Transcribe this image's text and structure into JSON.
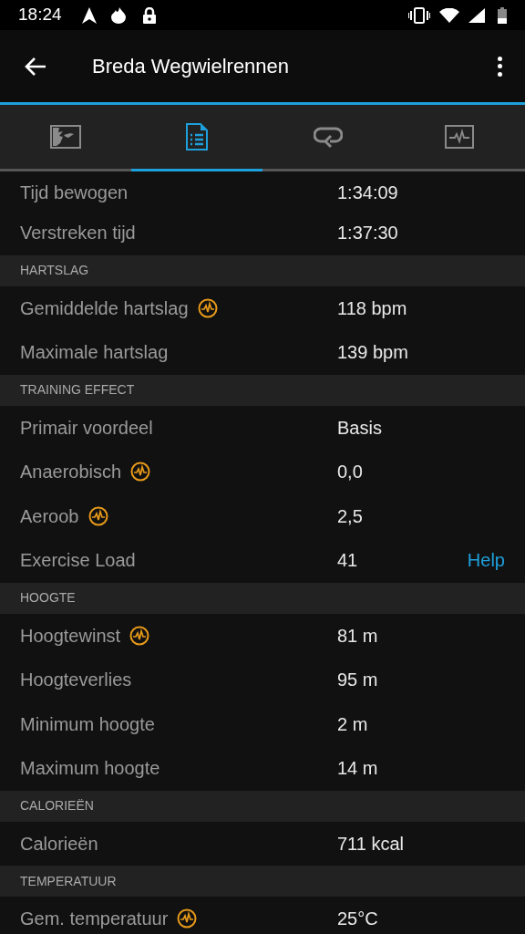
{
  "status_bar": {
    "time": "18:24"
  },
  "app_bar": {
    "title": "Breda Wegwielrennen"
  },
  "tabs": [
    {
      "kind": "map",
      "selected": false
    },
    {
      "kind": "details",
      "selected": true
    },
    {
      "kind": "laps",
      "selected": false
    },
    {
      "kind": "charts",
      "selected": false
    }
  ],
  "sections": [
    {
      "rows": [
        {
          "label": "Tijd bewogen",
          "value": "1:34:09",
          "badge": false
        },
        {
          "label": "Verstreken tijd",
          "value": "1:37:30",
          "badge": false
        }
      ]
    },
    {
      "heading": "HARTSLAG",
      "rows": [
        {
          "label": "Gemiddelde hartslag",
          "value": "118 bpm",
          "badge": true
        },
        {
          "label": "Maximale hartslag",
          "value": "139 bpm",
          "badge": false
        }
      ]
    },
    {
      "heading": "TRAINING EFFECT",
      "rows": [
        {
          "label": "Primair voordeel",
          "value": "Basis",
          "badge": false
        },
        {
          "label": "Anaerobisch",
          "value": "0,0",
          "badge": true
        },
        {
          "label": "Aeroob",
          "value": "2,5",
          "badge": true
        },
        {
          "label": "Exercise Load",
          "value": "41",
          "badge": false,
          "link": "Help"
        }
      ]
    },
    {
      "heading": "HOOGTE",
      "rows": [
        {
          "label": "Hoogtewinst",
          "value": "81 m",
          "badge": true
        },
        {
          "label": "Hoogteverlies",
          "value": "95 m",
          "badge": false
        },
        {
          "label": "Minimum hoogte",
          "value": "2 m",
          "badge": false
        },
        {
          "label": "Maximum hoogte",
          "value": "14 m",
          "badge": false
        }
      ]
    },
    {
      "heading": "CALORIEËN",
      "rows": [
        {
          "label": "Calorieën",
          "value": "711 kcal",
          "badge": false
        }
      ]
    },
    {
      "heading": "TEMPERATUUR",
      "rows": [
        {
          "label": "Gem. temperatuur",
          "value": "25°C",
          "badge": true
        }
      ]
    }
  ]
}
